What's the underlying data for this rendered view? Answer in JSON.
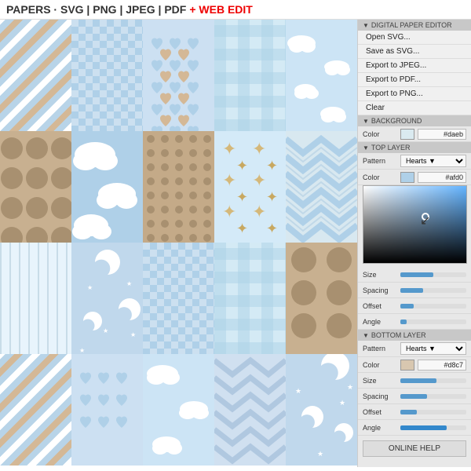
{
  "header": {
    "text": "PAPERS · SVG | PNG | JPEG | PDF",
    "web_edit": "+ WEB EDIT"
  },
  "editor": {
    "sections": {
      "digital_paper_editor": "DIGITAL PAPER EDITOR",
      "background": "BACKGROUND",
      "top_layer": "TOP LAYER",
      "bottom_layer": "BOTTOM LAYER"
    },
    "menu_items": [
      "Open SVG...",
      "Save as SVG...",
      "Export to JPEG...",
      "Export to PDF...",
      "Export to PNG...",
      "Clear"
    ],
    "background": {
      "color_label": "Color",
      "color_value": "#daeb"
    },
    "top_layer": {
      "pattern_label": "Pattern",
      "pattern_value": "Hearts ▼",
      "color_label": "Color",
      "color_value": "#afd0",
      "size_label": "Size",
      "spacing_label": "Spacing",
      "offset_label": "Offset",
      "angle_label": "Angle"
    },
    "bottom_layer": {
      "pattern_label": "Pattern",
      "pattern_value": "Hearts ▼",
      "color_label": "Color",
      "color_value": "#d8c7",
      "size_label": "Size",
      "spacing_label": "Spacing",
      "offset_label": "Offset",
      "angle_label": "Angle"
    },
    "online_help": "ONLINE HELP"
  },
  "sliders": {
    "top_size": 0.5,
    "top_spacing": 0.35,
    "top_offset": 0.2,
    "top_angle": 0.1,
    "bottom_size": 0.55,
    "bottom_spacing": 0.4,
    "bottom_offset": 0.25,
    "bottom_angle": 0.7
  }
}
